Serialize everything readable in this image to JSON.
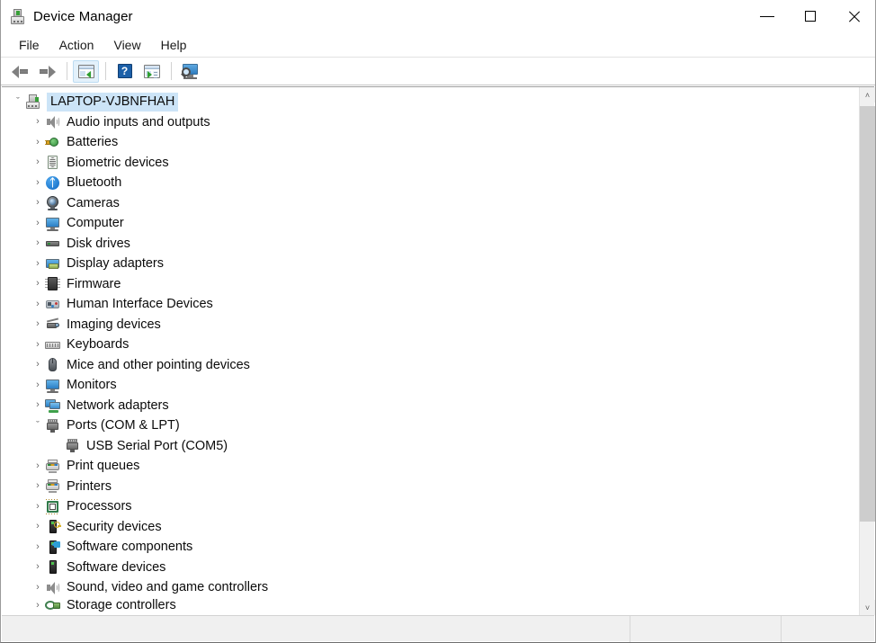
{
  "window": {
    "title": "Device Manager",
    "icon": "device-manager-icon",
    "buttons": {
      "minimize": "minimize-button",
      "maximize": "maximize-button",
      "close": "close-button"
    }
  },
  "menubar": {
    "items": [
      {
        "label": "File"
      },
      {
        "label": "Action"
      },
      {
        "label": "View"
      },
      {
        "label": "Help"
      }
    ]
  },
  "toolbar": {
    "items": [
      {
        "name": "back-button",
        "icon": "back-arrow-icon",
        "active": false
      },
      {
        "name": "forward-button",
        "icon": "forward-arrow-icon",
        "active": false
      },
      {
        "name": "separator-1",
        "icon": "separator",
        "active": false
      },
      {
        "name": "show-hide-console-tree-button",
        "icon": "console-tree-icon",
        "active": true
      },
      {
        "name": "separator-2",
        "icon": "separator",
        "active": false
      },
      {
        "name": "help-button",
        "icon": "help-icon",
        "label": "?",
        "active": false
      },
      {
        "name": "properties-button",
        "icon": "properties-icon",
        "active": false
      },
      {
        "name": "separator-3",
        "icon": "separator",
        "active": false
      },
      {
        "name": "scan-for-hardware-changes-button",
        "icon": "scan-monitor-icon",
        "active": false
      }
    ]
  },
  "tree": {
    "root": {
      "label": "LAPTOP-VJBNFHAH",
      "icon": "computer-icon",
      "expanded": true,
      "selected": true,
      "chevron": "ˇ"
    },
    "nodes": [
      {
        "label": "Audio inputs and outputs",
        "icon": "speaker-icon",
        "level": 1,
        "chevron": "›",
        "expanded": false
      },
      {
        "label": "Batteries",
        "icon": "battery-icon",
        "level": 1,
        "chevron": "›",
        "expanded": false
      },
      {
        "label": "Biometric devices",
        "icon": "fingerprint-icon",
        "level": 1,
        "chevron": "›",
        "expanded": false
      },
      {
        "label": "Bluetooth",
        "icon": "bluetooth-icon",
        "level": 1,
        "chevron": "›",
        "expanded": false
      },
      {
        "label": "Cameras",
        "icon": "camera-icon",
        "level": 1,
        "chevron": "›",
        "expanded": false
      },
      {
        "label": "Computer",
        "icon": "monitor-icon",
        "level": 1,
        "chevron": "›",
        "expanded": false
      },
      {
        "label": "Disk drives",
        "icon": "disk-drive-icon",
        "level": 1,
        "chevron": "›",
        "expanded": false
      },
      {
        "label": "Display adapters",
        "icon": "display-adapter-icon",
        "level": 1,
        "chevron": "›",
        "expanded": false
      },
      {
        "label": "Firmware",
        "icon": "firmware-chip-icon",
        "level": 1,
        "chevron": "›",
        "expanded": false
      },
      {
        "label": "Human Interface Devices",
        "icon": "hid-gamepad-icon",
        "level": 1,
        "chevron": "›",
        "expanded": false
      },
      {
        "label": "Imaging devices",
        "icon": "imaging-scanner-icon",
        "level": 1,
        "chevron": "›",
        "expanded": false
      },
      {
        "label": "Keyboards",
        "icon": "keyboard-icon",
        "level": 1,
        "chevron": "›",
        "expanded": false
      },
      {
        "label": "Mice and other pointing devices",
        "icon": "mouse-icon",
        "level": 1,
        "chevron": "›",
        "expanded": false
      },
      {
        "label": "Monitors",
        "icon": "monitor-icon",
        "level": 1,
        "chevron": "›",
        "expanded": false
      },
      {
        "label": "Network adapters",
        "icon": "network-adapter-icon",
        "level": 1,
        "chevron": "›",
        "expanded": false
      },
      {
        "label": "Ports (COM & LPT)",
        "icon": "port-connector-icon",
        "level": 1,
        "chevron": "ˇ",
        "expanded": true
      },
      {
        "label": "USB Serial Port (COM5)",
        "icon": "port-connector-icon",
        "level": 2,
        "chevron": "",
        "expanded": false
      },
      {
        "label": "Print queues",
        "icon": "printer-icon",
        "level": 1,
        "chevron": "›",
        "expanded": false
      },
      {
        "label": "Printers",
        "icon": "printer-icon",
        "level": 1,
        "chevron": "›",
        "expanded": false
      },
      {
        "label": "Processors",
        "icon": "processor-icon",
        "level": 1,
        "chevron": "›",
        "expanded": false
      },
      {
        "label": "Security devices",
        "icon": "security-device-icon",
        "level": 1,
        "chevron": "›",
        "expanded": false
      },
      {
        "label": "Software components",
        "icon": "software-component-icon",
        "level": 1,
        "chevron": "›",
        "expanded": false
      },
      {
        "label": "Software devices",
        "icon": "software-device-icon",
        "level": 1,
        "chevron": "›",
        "expanded": false
      },
      {
        "label": "Sound, video and game controllers",
        "icon": "speaker-icon",
        "level": 1,
        "chevron": "›",
        "expanded": false
      },
      {
        "label": "Storage controllers",
        "icon": "storage-controller-icon",
        "level": 1,
        "chevron": "›",
        "expanded": false,
        "clipped": true
      }
    ]
  },
  "scrollbar": {
    "up_arrow": "˄",
    "down_arrow": "˅"
  },
  "statusbar": {
    "panels": [
      "",
      "",
      ""
    ]
  },
  "colors": {
    "selection": "#cce4f7",
    "accent": "#2b7ec4",
    "toolbar_active": "#e3f1fb",
    "scrollbar_thumb": "#cdcdcd",
    "statusbar_bg": "#f0f0f0"
  }
}
